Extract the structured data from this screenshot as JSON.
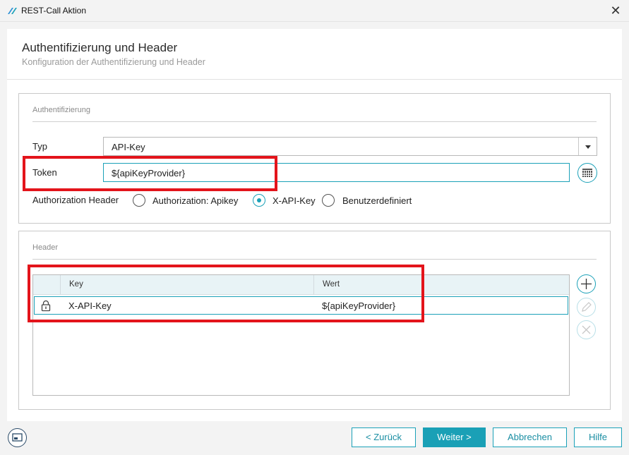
{
  "window": {
    "title": "REST-Call Aktion",
    "close_glyph": "✕",
    "app_icon": "app-logo-icon"
  },
  "header": {
    "title": "Authentifizierung und Header",
    "subtitle": "Konfiguration der Authentifizierung und Header"
  },
  "auth": {
    "section_title": "Authentifizierung",
    "type_label": "Typ",
    "type_value": "API-Key",
    "token_label": "Token",
    "token_value": "${apiKeyProvider}",
    "authorization_header_label": "Authorization Header",
    "options": [
      {
        "label": "Authorization: Apikey",
        "selected": false
      },
      {
        "label": "X-API-Key",
        "selected": true
      },
      {
        "label": "Benutzerdefiniert",
        "selected": false
      }
    ]
  },
  "headers": {
    "section_title": "Header",
    "columns": [
      "Key",
      "Wert"
    ],
    "rows": [
      {
        "key": "X-API-Key",
        "value": "${apiKeyProvider}",
        "locked": true
      }
    ]
  },
  "footer": {
    "back_label": "< Zurück",
    "next_label": "Weiter >",
    "cancel_label": "Abbrechen",
    "help_label": "Hilfe"
  },
  "colors": {
    "accent": "#1ba1b8",
    "highlight": "#e3141b",
    "primary_button": "#1aa0b6"
  }
}
